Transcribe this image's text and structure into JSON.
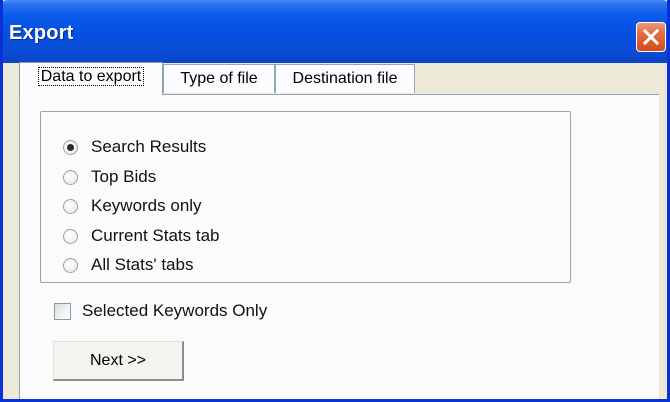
{
  "window": {
    "title": "Export"
  },
  "tabs": [
    {
      "label": "Data to export",
      "active": true
    },
    {
      "label": "Type of file",
      "active": false
    },
    {
      "label": "Destination file",
      "active": false
    }
  ],
  "options": [
    {
      "label": "Search Results",
      "checked": true
    },
    {
      "label": "Top Bids",
      "checked": false
    },
    {
      "label": "Keywords only",
      "checked": false
    },
    {
      "label": "Current Stats tab",
      "checked": false
    },
    {
      "label": "All Stats' tabs",
      "checked": false
    }
  ],
  "selected_keywords": {
    "label": "Selected Keywords Only",
    "checked": false
  },
  "next_button": {
    "label": "Next >>"
  },
  "colors": {
    "titlebar": "#0550e0",
    "close": "#e36b41",
    "window_bg": "#ece9d8"
  }
}
